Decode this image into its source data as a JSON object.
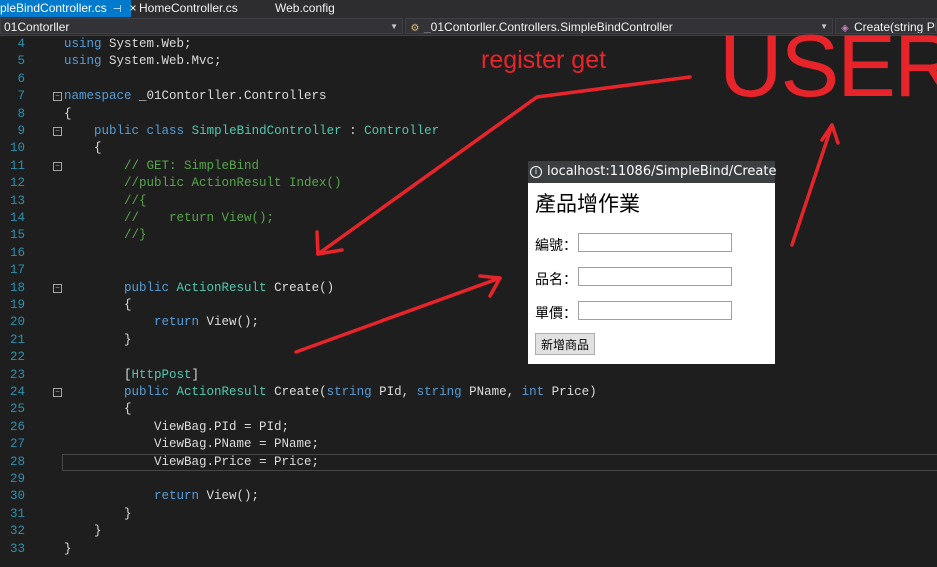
{
  "tabs": [
    {
      "label": "pleBindController.cs",
      "pin": "⊣",
      "close": "×",
      "active": true
    },
    {
      "label": "HomeController.cs",
      "active": false
    },
    {
      "label": "Web.config",
      "active": false
    }
  ],
  "nav": {
    "project": "01Contorller",
    "class_path": "_01Contorller.Controllers.SimpleBindController",
    "member": "Create(string PId"
  },
  "code_lines": [
    {
      "n": "4",
      "parts": [
        [
          "using",
          "kw"
        ],
        [
          " System.Web;",
          ""
        ]
      ]
    },
    {
      "n": "5",
      "parts": [
        [
          "using",
          "kw"
        ],
        [
          " System.Web.Mvc;",
          ""
        ]
      ]
    },
    {
      "n": "6",
      "parts": []
    },
    {
      "n": "7",
      "fold": "−",
      "parts": [
        [
          "namespace",
          "kw"
        ],
        [
          " _01Contorller.Controllers",
          ""
        ]
      ]
    },
    {
      "n": "8",
      "parts": [
        [
          "{",
          ""
        ]
      ]
    },
    {
      "n": "9",
      "fold": "−",
      "parts": [
        [
          "    ",
          ""
        ],
        [
          "public",
          "kw"
        ],
        [
          " ",
          ""
        ],
        [
          "class",
          "kw"
        ],
        [
          " ",
          ""
        ],
        [
          "SimpleBindController",
          "ty"
        ],
        [
          " : ",
          ""
        ],
        [
          "Controller",
          "ty"
        ]
      ]
    },
    {
      "n": "10",
      "parts": [
        [
          "    {",
          ""
        ]
      ]
    },
    {
      "n": "11",
      "fold": "−",
      "parts": [
        [
          "        ",
          ""
        ],
        [
          "// GET: SimpleBind",
          "cm"
        ]
      ]
    },
    {
      "n": "12",
      "parts": [
        [
          "        ",
          ""
        ],
        [
          "//public ActionResult Index()",
          "cm"
        ]
      ]
    },
    {
      "n": "13",
      "parts": [
        [
          "        ",
          ""
        ],
        [
          "//{",
          "cm"
        ]
      ]
    },
    {
      "n": "14",
      "parts": [
        [
          "        ",
          ""
        ],
        [
          "//    return View();",
          "cm"
        ]
      ]
    },
    {
      "n": "15",
      "parts": [
        [
          "        ",
          ""
        ],
        [
          "//}",
          "cm"
        ]
      ]
    },
    {
      "n": "16",
      "parts": []
    },
    {
      "n": "17",
      "parts": []
    },
    {
      "n": "18",
      "fold": "−",
      "parts": [
        [
          "        ",
          ""
        ],
        [
          "public",
          "kw"
        ],
        [
          " ",
          ""
        ],
        [
          "ActionResult",
          "ty"
        ],
        [
          " Create()",
          ""
        ]
      ]
    },
    {
      "n": "19",
      "parts": [
        [
          "        {",
          ""
        ]
      ]
    },
    {
      "n": "20",
      "parts": [
        [
          "            ",
          ""
        ],
        [
          "return",
          "kw"
        ],
        [
          " View();",
          ""
        ]
      ]
    },
    {
      "n": "21",
      "parts": [
        [
          "        }",
          ""
        ]
      ]
    },
    {
      "n": "22",
      "parts": []
    },
    {
      "n": "23",
      "parts": [
        [
          "        [",
          ""
        ],
        [
          "HttpPost",
          "ty"
        ],
        [
          "]",
          ""
        ]
      ]
    },
    {
      "n": "24",
      "fold": "−",
      "parts": [
        [
          "        ",
          ""
        ],
        [
          "public",
          "kw"
        ],
        [
          " ",
          ""
        ],
        [
          "ActionResult",
          "ty"
        ],
        [
          " Create(",
          ""
        ],
        [
          "string",
          "kw"
        ],
        [
          " PId, ",
          ""
        ],
        [
          "string",
          "kw"
        ],
        [
          " PName, ",
          ""
        ],
        [
          "int",
          "kw"
        ],
        [
          " Price)",
          ""
        ]
      ]
    },
    {
      "n": "25",
      "parts": [
        [
          "        {",
          ""
        ]
      ]
    },
    {
      "n": "26",
      "parts": [
        [
          "            ViewBag.PId = PId;",
          ""
        ]
      ]
    },
    {
      "n": "27",
      "parts": [
        [
          "            ViewBag.PName = PName;",
          ""
        ]
      ]
    },
    {
      "n": "28",
      "current": true,
      "parts": [
        [
          "            ViewBag.Price = Price;",
          ""
        ]
      ]
    },
    {
      "n": "29",
      "parts": []
    },
    {
      "n": "30",
      "parts": [
        [
          "            ",
          ""
        ],
        [
          "return",
          "kw"
        ],
        [
          " View();",
          ""
        ]
      ]
    },
    {
      "n": "31",
      "parts": [
        [
          "        }",
          ""
        ]
      ]
    },
    {
      "n": "32",
      "parts": [
        [
          "    }",
          ""
        ]
      ]
    },
    {
      "n": "33",
      "parts": [
        [
          "}",
          ""
        ]
      ]
    }
  ],
  "browser": {
    "url": "localhost:11086/SimpleBind/Create",
    "title": "產品增作業",
    "fields": [
      {
        "label": "編號：",
        "value": ""
      },
      {
        "label": "品名：",
        "value": ""
      },
      {
        "label": "單價：",
        "value": ""
      }
    ],
    "submit": "新增商品"
  },
  "annotations": {
    "label1": "register   get",
    "label2": "USER",
    "color": "#e8242b"
  },
  "colors": {
    "keyword": "#569cd6",
    "type": "#4ec9b0",
    "comment": "#57a64a",
    "line_number": "#2b91af",
    "tab_active": "#007acc"
  }
}
